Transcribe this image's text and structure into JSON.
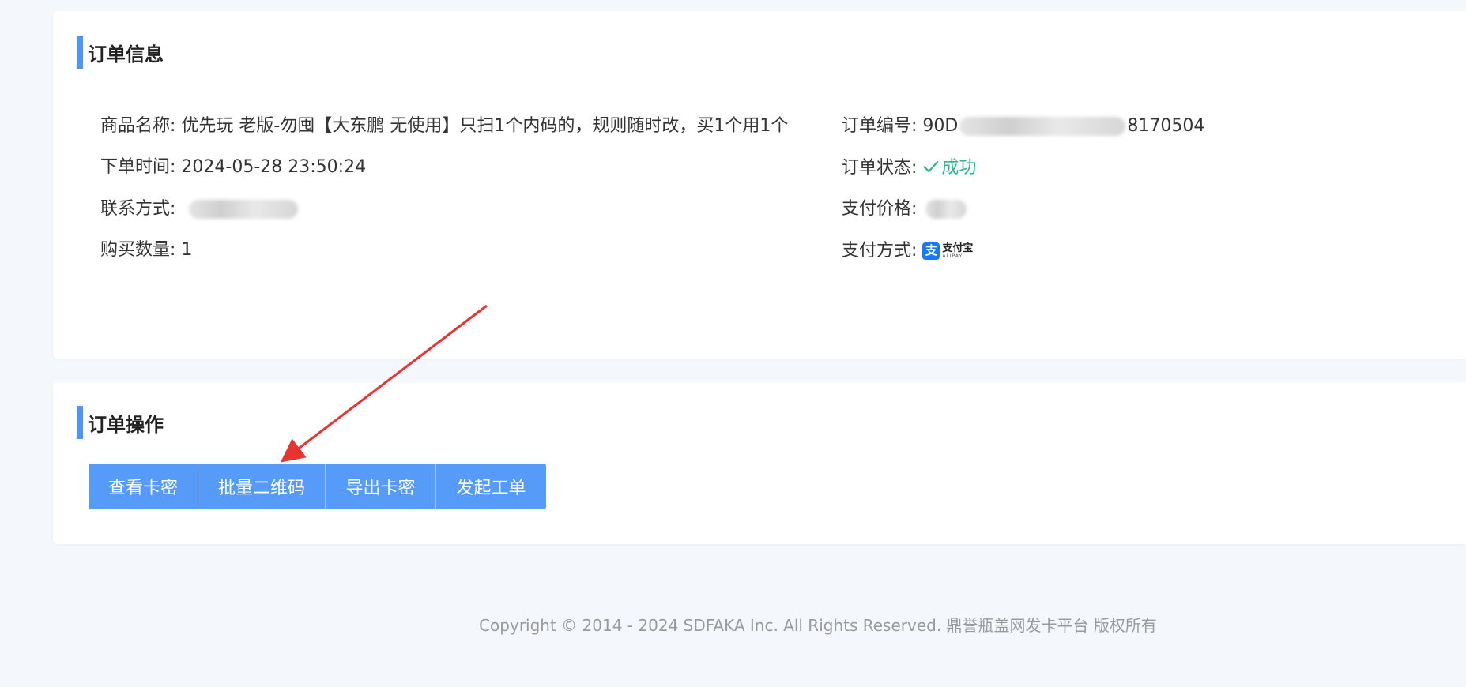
{
  "order_info": {
    "title": "订单信息",
    "product_name_label": "商品名称:",
    "product_name": "优先玩 老版-勿囤【大东鹏 无使用】只扫1个内码的，规则随时改，买1个用1个",
    "order_time_label": "下单时间:",
    "order_time": "2024-05-28 23:50:24",
    "contact_label": "联系方式:",
    "quantity_label": "购买数量:",
    "quantity": "1",
    "order_no_label": "订单编号:",
    "order_no_prefix": "90D",
    "order_no_suffix": "8170504",
    "status_label": "订单状态:",
    "status_value": "成功",
    "status_color": "#2bb58f",
    "price_label": "支付价格:",
    "payment_label": "支付方式:",
    "payment_icon": "alipay-logo",
    "alipay_cn": "支付宝",
    "alipay_en": "ALIPAY"
  },
  "order_ops": {
    "title": "订单操作",
    "buttons": [
      {
        "label": "查看卡密"
      },
      {
        "label": "批量二维码"
      },
      {
        "label": "导出卡密"
      },
      {
        "label": "发起工单"
      }
    ],
    "button_color": "#559bf7",
    "accent_color": "#4f94f7"
  },
  "footer": {
    "copyright": "Copyright © 2014 - 2024 SDFAKA Inc. All Rights Reserved. 鼎誉瓶盖网发卡平台 版权所有"
  }
}
